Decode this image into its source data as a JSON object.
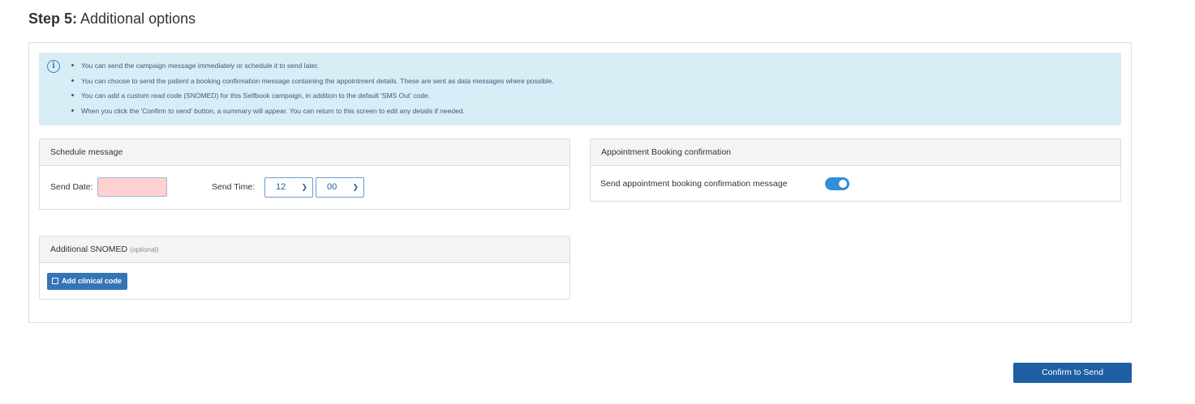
{
  "page": {
    "step_number": "Step 5:",
    "step_title": "Additional options"
  },
  "info": {
    "items": [
      "You can send the campaign message immediately or schedule it to send later.",
      "You can choose to send the patient a booking confirmation message containing the appointment details. These are sent as data messages where possible.",
      "You can add a custom read code (SNOMED) for this Selfbook campaign, in addition to the default 'SMS Out' code.",
      "When you click the 'Confirm to send' button, a summary will appear. You can return to this screen to edit any details if needed."
    ]
  },
  "schedule": {
    "title": "Schedule message",
    "send_date_label": "Send Date:",
    "send_date_value": "",
    "send_time_label": "Send Time:",
    "hour": "12",
    "minute": "00"
  },
  "booking": {
    "title": "Appointment Booking confirmation",
    "toggle_label": "Send appointment booking confirmation message",
    "toggle_on": true
  },
  "snomed": {
    "title": "Additional SNOMED",
    "optional_label": "(optional)",
    "add_button_label": "Add clinical code"
  },
  "actions": {
    "confirm_label": "Confirm to Send"
  },
  "colors": {
    "info_background": "#d9edf7",
    "primary": "#1e5fa3",
    "toggle_on": "#2f8fd8",
    "invalid_input": "#ffd1d1"
  }
}
